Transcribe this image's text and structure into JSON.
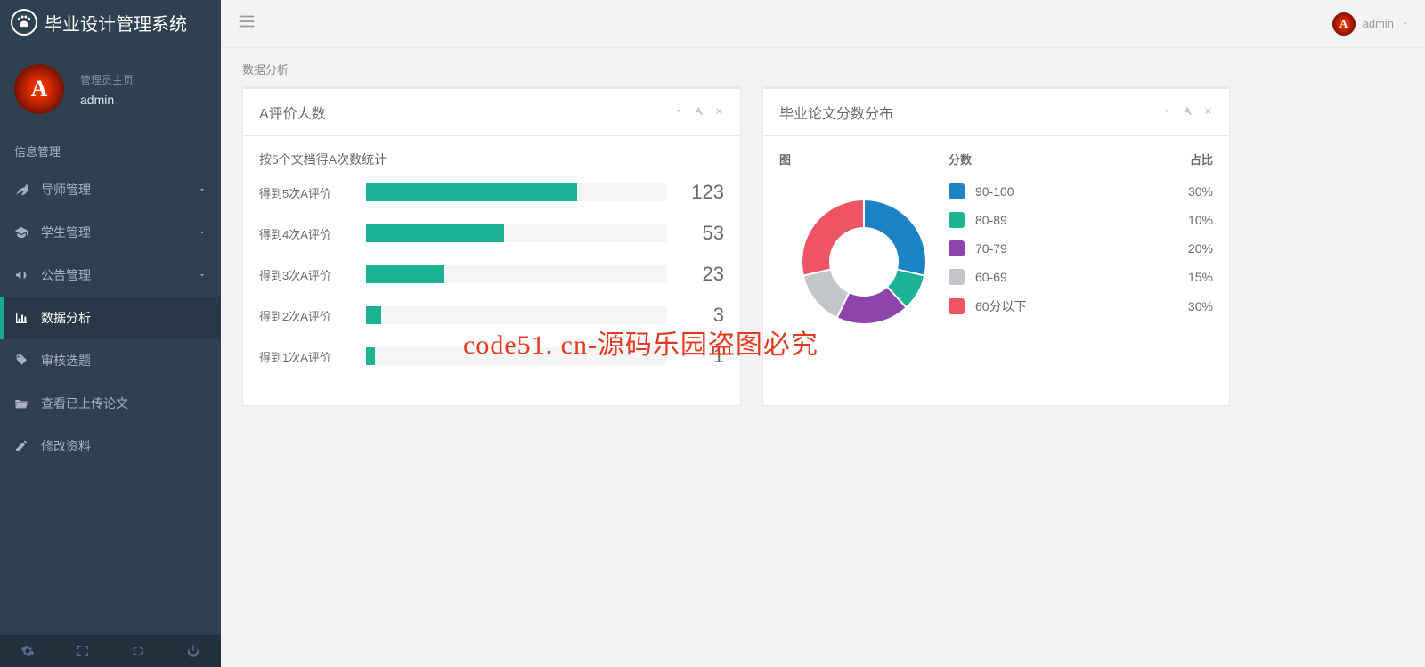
{
  "header": {
    "app_title": "毕业设计管理系统"
  },
  "profile": {
    "role": "管理员主页",
    "name": "admin",
    "avatar_letter": "A"
  },
  "sidebar": {
    "section_label": "信息管理",
    "items": [
      {
        "label": "导师管理",
        "icon": "leaf-icon",
        "expandable": true
      },
      {
        "label": "学生管理",
        "icon": "graduation-icon",
        "expandable": true
      },
      {
        "label": "公告管理",
        "icon": "bullhorn-icon",
        "expandable": true
      },
      {
        "label": "数据分析",
        "icon": "bar-chart-icon",
        "expandable": false,
        "active": true
      },
      {
        "label": "审核选题",
        "icon": "tag-icon",
        "expandable": false
      },
      {
        "label": "查看已上传论文",
        "icon": "folder-open-icon",
        "expandable": false
      },
      {
        "label": "修改资料",
        "icon": "edit-icon",
        "expandable": false
      }
    ]
  },
  "topbar": {
    "user": "admin"
  },
  "breadcrumb": "数据分析",
  "panel_a": {
    "title": "A评价人数",
    "subtitle": "按5个文档得A次数统计",
    "bars": [
      {
        "label": "得到5次A评价",
        "value": 123,
        "pct": 70
      },
      {
        "label": "得到4次A评价",
        "value": 53,
        "pct": 46
      },
      {
        "label": "得到3次A评价",
        "value": 23,
        "pct": 26
      },
      {
        "label": "得到2次A评价",
        "value": 3,
        "pct": 5
      },
      {
        "label": "得到1次A评价",
        "value": 1,
        "pct": 3
      }
    ]
  },
  "panel_b": {
    "title": "毕业论文分数分布",
    "headers": {
      "chart": "图",
      "score": "分数",
      "ratio": "占比"
    },
    "rows": [
      {
        "label": "90-100",
        "pct": "30%",
        "color": "#1c84c6"
      },
      {
        "label": "80-89",
        "pct": "10%",
        "color": "#1ab394"
      },
      {
        "label": "70-79",
        "pct": "20%",
        "color": "#8e44ad"
      },
      {
        "label": "60-69",
        "pct": "15%",
        "color": "#c2c6cb"
      },
      {
        "label": "60分以下",
        "pct": "30%",
        "color": "#ed5565"
      }
    ]
  },
  "watermark": "code51. cn-源码乐园盗图必究",
  "chart_data": [
    {
      "type": "bar",
      "title": "A评价人数",
      "subtitle": "按5个文档得A次数统计",
      "orientation": "horizontal",
      "categories": [
        "得到5次A评价",
        "得到4次A评价",
        "得到3次A评价",
        "得到2次A评价",
        "得到1次A评价"
      ],
      "values": [
        123,
        53,
        23,
        3,
        1
      ],
      "color": "#1ab394"
    },
    {
      "type": "pie",
      "subtype": "donut",
      "title": "毕业论文分数分布",
      "categories": [
        "90-100",
        "80-89",
        "70-79",
        "60-69",
        "60分以下"
      ],
      "values": [
        30,
        10,
        20,
        15,
        30
      ],
      "colors": [
        "#1c84c6",
        "#1ab394",
        "#8e44ad",
        "#c2c6cb",
        "#ed5565"
      ],
      "legend_headers": [
        "图",
        "分数",
        "占比"
      ]
    }
  ]
}
